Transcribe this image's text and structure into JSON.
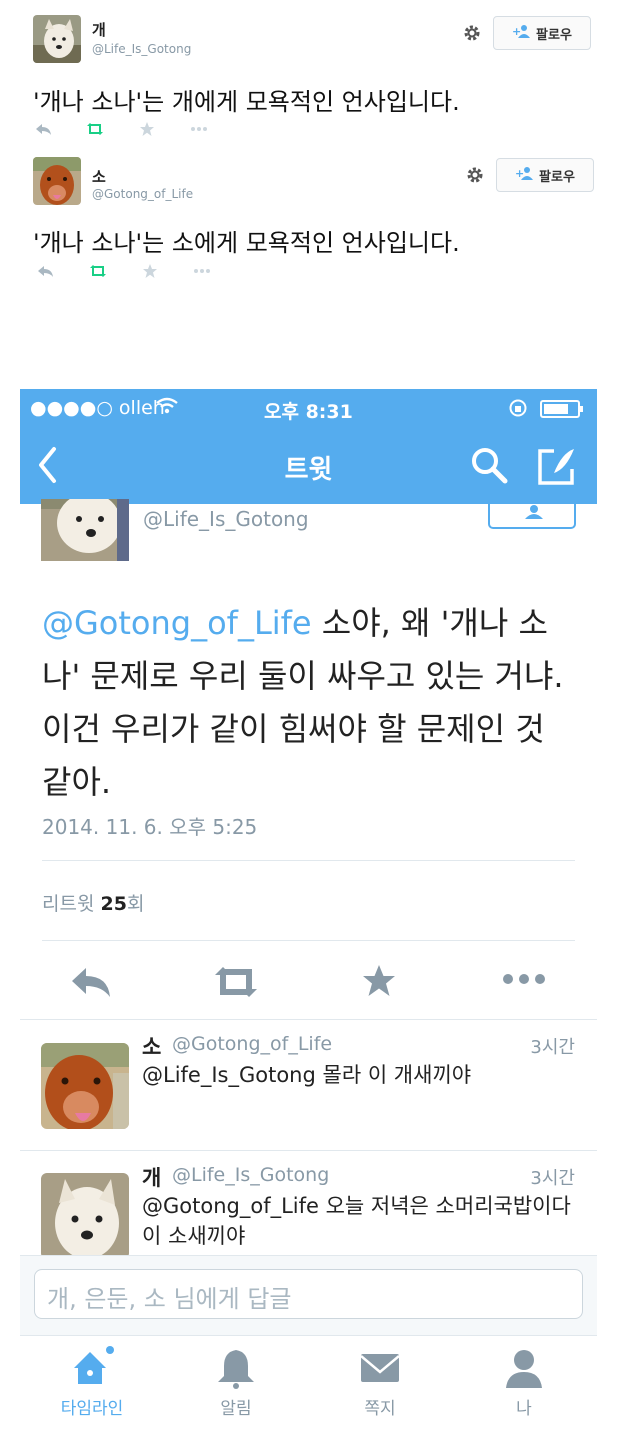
{
  "cards": [
    {
      "name": "개",
      "handle": "@Life_Is_Gotong",
      "follow_label": "팔로우",
      "text": "'개나 소나'는 개에게 모욕적인 언사입니다."
    },
    {
      "name": "소",
      "handle": "@Gotong_of_Life",
      "follow_label": "팔로우",
      "text": "'개나 소나'는 소에게 모욕적인 언사입니다."
    }
  ],
  "status_bar": {
    "carrier": "●●●●○ olleh",
    "time": "오후 8:31"
  },
  "nav": {
    "title": "트윗"
  },
  "detail": {
    "handle": "@Life_Is_Gotong",
    "mention": "@Gotong_of_Life",
    "text_after_mention": " 소야, 왜 '개나 소나' 문제로 우리 둘이 싸우고 있는 거냐. 이건 우리가 같이 힘써야 할 문제인 것 같아.",
    "timestamp": "2014. 11. 6. 오후 5:25",
    "retweet_label": "리트윗",
    "retweet_count": "25",
    "retweet_suffix": "회"
  },
  "replies": [
    {
      "name": "소",
      "handle": "@Gotong_of_Life",
      "time": "3시간",
      "text": "@Life_Is_Gotong 몰라 이 개새끼야"
    },
    {
      "name": "개",
      "handle": "@Life_Is_Gotong",
      "time": "3시간",
      "text": "@Gotong_of_Life 오늘 저녁은 소머리국밥이다 이 소새끼야"
    }
  ],
  "compose": {
    "placeholder": "개, 은둔, 소 님에게 답글"
  },
  "tabs": [
    {
      "label": "타임라인",
      "icon": "home-icon",
      "active": true
    },
    {
      "label": "알림",
      "icon": "bell-icon",
      "active": false
    },
    {
      "label": "쪽지",
      "icon": "envelope-icon",
      "active": false
    },
    {
      "label": "나",
      "icon": "person-icon",
      "active": false
    }
  ],
  "colors": {
    "twitter_blue": "#55acee",
    "retweet_green": "#19cf86",
    "muted": "#8899a6"
  }
}
